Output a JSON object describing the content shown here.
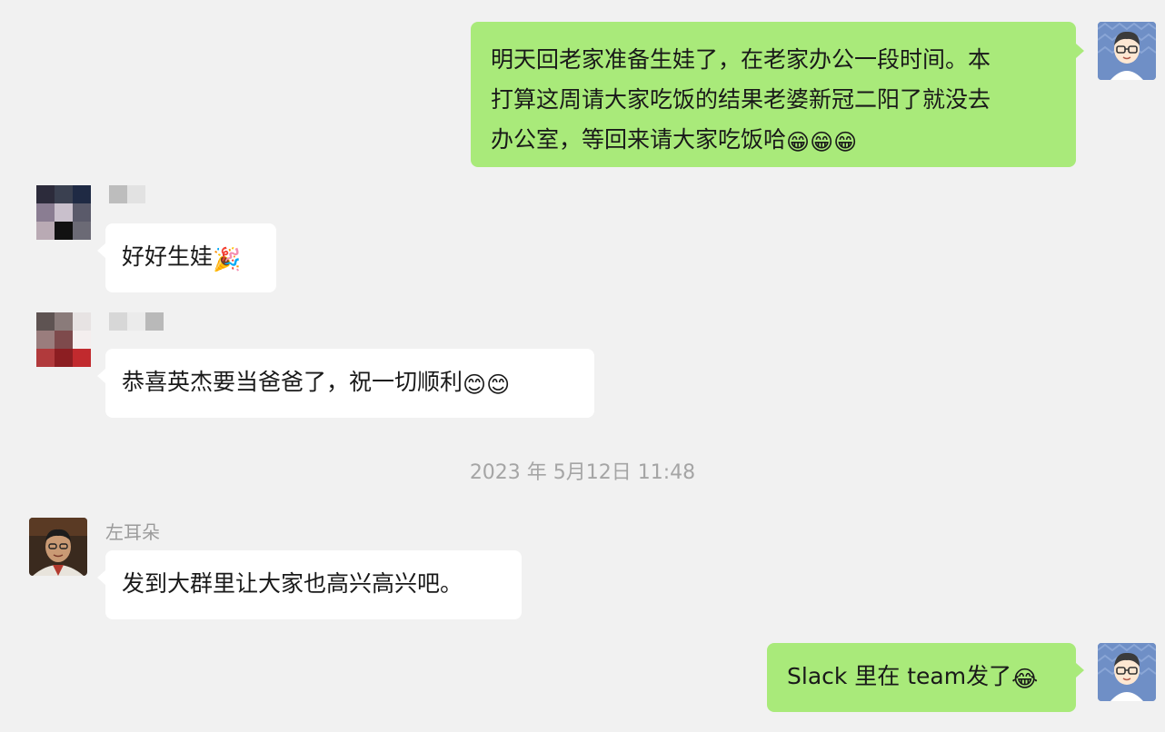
{
  "messages": [
    {
      "id": "msg1",
      "direction": "outgoing",
      "lines": [
        "明天回老家准备生娃了，在老家办公一段时间。本",
        "打算这周请大家吃饭的结果老婆新冠二阳了就没去",
        "办公室，等回来请大家吃饭哈"
      ],
      "emojis": [
        "😁",
        "😁",
        "😁"
      ]
    },
    {
      "id": "msg2",
      "direction": "incoming",
      "text": "好好生娃",
      "emojis": [
        "🎉"
      ]
    },
    {
      "id": "msg3",
      "direction": "incoming",
      "text": "恭喜英杰要当爸爸了，祝一切顺利",
      "emojis": [
        "😊",
        "😊"
      ]
    },
    {
      "id": "msg4",
      "direction": "incoming",
      "sender": "左耳朵",
      "text": "发到大群里让大家也高兴高兴吧。"
    },
    {
      "id": "msg5",
      "direction": "outgoing",
      "text": "Slack 里在 team发了",
      "emojis": [
        "😂"
      ]
    }
  ],
  "timestamp": "2023 年 5月12日 11:48",
  "colors": {
    "background": "#f1f1f1",
    "outgoing_bubble": "#a9ea7a",
    "incoming_bubble": "#ffffff",
    "meta_text": "#a5a5a5"
  }
}
